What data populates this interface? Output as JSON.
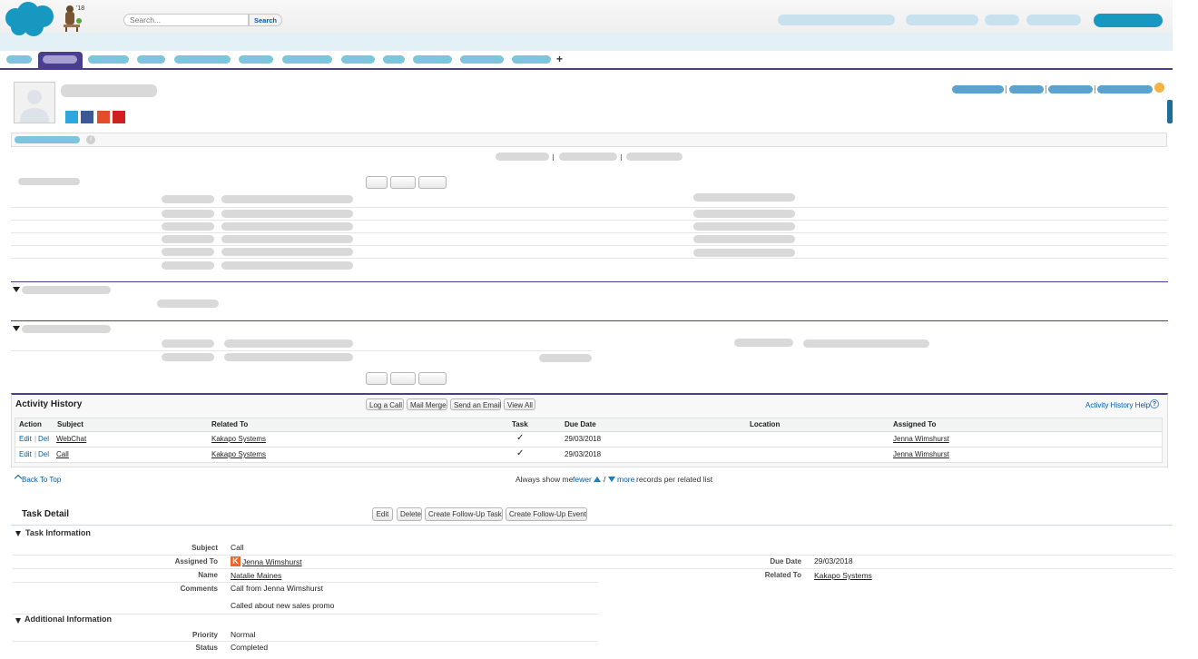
{
  "header": {
    "search_placeholder": "Search...",
    "search_button": "Search",
    "year_badge": "'18"
  },
  "tabs": {
    "add_symbol": "+"
  },
  "activity_history": {
    "title": "Activity History",
    "buttons": [
      "Log a Call",
      "Mail Merge",
      "Send an Email",
      "View All"
    ],
    "help_link": "Activity History Help",
    "help_icon": "?",
    "columns": [
      "Action",
      "Subject",
      "Related To",
      "Task",
      "Due Date",
      "Location",
      "Assigned To"
    ],
    "rows": [
      {
        "edit": "Edit",
        "sep": "|",
        "del": "Del",
        "subject": "WebChat",
        "related_to": "Kakapo Systems",
        "task": "✓",
        "due_date": "29/03/2018",
        "location": "",
        "assigned_to": "Jenna Wimshurst"
      },
      {
        "edit": "Edit",
        "sep": "|",
        "del": "Del",
        "subject": "Call",
        "related_to": "Kakapo Systems",
        "task": "✓",
        "due_date": "29/03/2018",
        "location": "",
        "assigned_to": "Jenna Wimshurst"
      }
    ]
  },
  "footer_nav": {
    "back_to_top": "Back To Top",
    "always_show": "Always show me",
    "fewer": "fewer",
    "slash": "/",
    "more": "more",
    "per_list": "records per related list"
  },
  "task_detail": {
    "title": "Task Detail",
    "buttons": [
      "Edit",
      "Delete",
      "Create Follow-Up Task",
      "Create Follow-Up Event"
    ],
    "section_task_info": "Task Information",
    "subject_label": "Subject",
    "subject_value": "Call",
    "assigned_to_label": "Assigned To",
    "assigned_to_value": "Jenna Wimshurst",
    "assigned_badge": "K",
    "due_date_label": "Due Date",
    "due_date_value": "29/03/2018",
    "name_label": "Name",
    "name_value": "Natalie Maines",
    "related_to_label": "Related To",
    "related_to_value": "Kakapo Systems",
    "comments_label": "Comments",
    "comments_line1": "Call from Jenna Wimshurst",
    "comments_line2": "Called about new sales promo",
    "section_additional": "Additional Information",
    "priority_label": "Priority",
    "priority_value": "Normal",
    "status_label": "Status",
    "status_value": "Completed"
  },
  "colors": {
    "brand_blue": "#1798c1",
    "tab_bar_top": "#e9f4f9",
    "accent_purple": "#4a3f8f",
    "link": "#015ba7"
  },
  "icons": [
    "salesforce-cloud-logo",
    "bear-mascot-icon",
    "avatar-icon",
    "twitter-icon",
    "facebook-icon",
    "youtube-icon",
    "klout-icon",
    "info-icon",
    "collapse-triangle-icon",
    "check-icon",
    "up-arrow-icon",
    "down-arrow-icon"
  ]
}
